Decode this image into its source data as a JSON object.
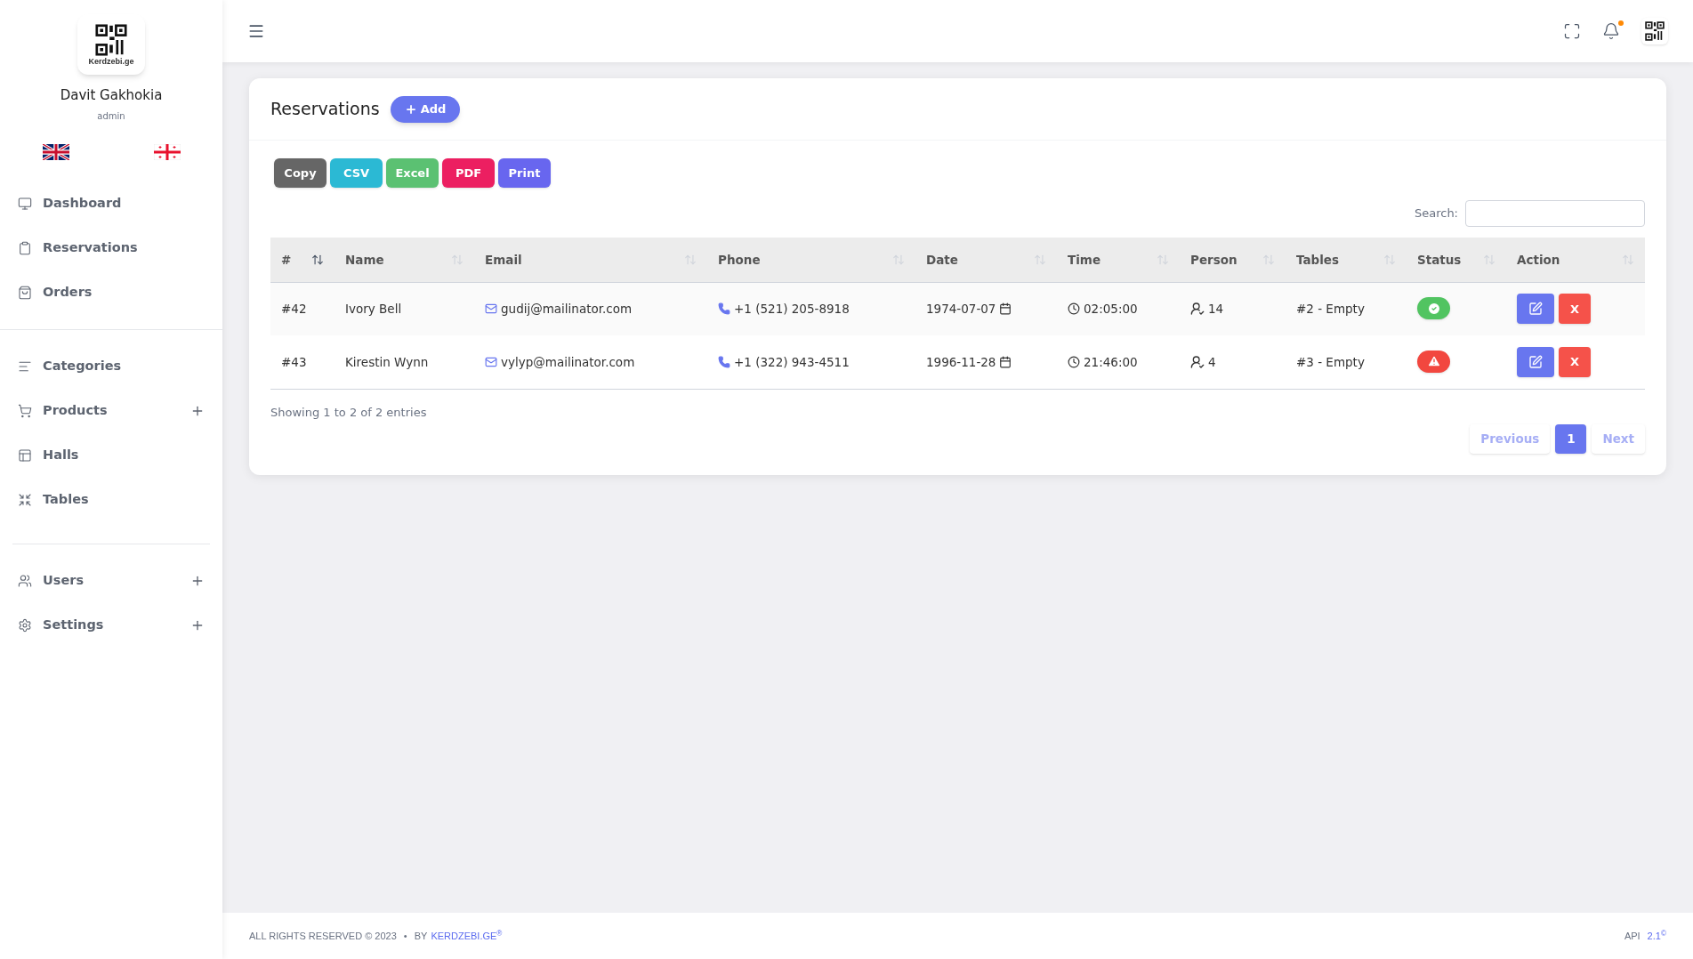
{
  "sidebar": {
    "logo_text": "Kerdzebi.ge",
    "user": {
      "name": "Davit Gakhokia",
      "role": "admin"
    },
    "groups": [
      [
        {
          "label": "Dashboard",
          "expandable": false
        },
        {
          "label": "Reservations",
          "expandable": false
        },
        {
          "label": "Orders",
          "expandable": false
        }
      ],
      [
        {
          "label": "Categories",
          "expandable": false
        },
        {
          "label": "Products",
          "expandable": true
        },
        {
          "label": "Halls",
          "expandable": false
        },
        {
          "label": "Tables",
          "expandable": false
        }
      ],
      [
        {
          "label": "Users",
          "expandable": true
        },
        {
          "label": "Settings",
          "expandable": true
        }
      ]
    ]
  },
  "header": {
    "notification_dot": true
  },
  "card": {
    "title": "Reservations",
    "add_button": "Add",
    "export_buttons": [
      {
        "label": "Copy",
        "color": "#666666"
      },
      {
        "label": "CSV",
        "color": "#2bb9d4"
      },
      {
        "label": "Excel",
        "color": "#5bc172"
      },
      {
        "label": "PDF",
        "color": "#ec1f61"
      },
      {
        "label": "Print",
        "color": "#6866ef"
      }
    ],
    "search": {
      "label": "Search:"
    },
    "table": {
      "columns": [
        {
          "label": "#",
          "sorted": true
        },
        {
          "label": "Name",
          "sorted": false
        },
        {
          "label": "Email",
          "sorted": false
        },
        {
          "label": "Phone",
          "sorted": false
        },
        {
          "label": "Date",
          "sorted": false
        },
        {
          "label": "Time",
          "sorted": false
        },
        {
          "label": "Person",
          "sorted": false
        },
        {
          "label": "Tables",
          "sorted": false
        },
        {
          "label": "Status",
          "sorted": false
        },
        {
          "label": "Action",
          "sorted": false
        }
      ],
      "rows": [
        {
          "id": "#42",
          "name": "Ivory Bell",
          "email": "gudij@mailinator.com",
          "phone": "+1 (521) 205-8918",
          "date": "1974-07-07",
          "time": "02:05:00",
          "person": "14",
          "table": "#2 - Empty",
          "status": {
            "kind": "success"
          },
          "delete_label": "X"
        },
        {
          "id": "#43",
          "name": "Kirestin Wynn",
          "email": "vylyp@mailinator.com",
          "phone": "+1 (322) 943-4511",
          "date": "1996-11-28",
          "time": "21:46:00",
          "person": "4",
          "table": "#3 - Empty",
          "status": {
            "kind": "warning"
          },
          "delete_label": "X"
        }
      ]
    },
    "info": "Showing 1 to 2 of 2 entries",
    "pagination": {
      "previous": "Previous",
      "pages": [
        {
          "label": "1",
          "selected": true
        }
      ],
      "next": "Next"
    }
  },
  "footer": {
    "copyright": "ALL RIGHTS RESERVED © 2023",
    "separator": "•",
    "by": "BY",
    "brand": "KERDZEBI.GE$^{®}$",
    "api_label": "API",
    "api_version": "2.1$^{©}$"
  }
}
